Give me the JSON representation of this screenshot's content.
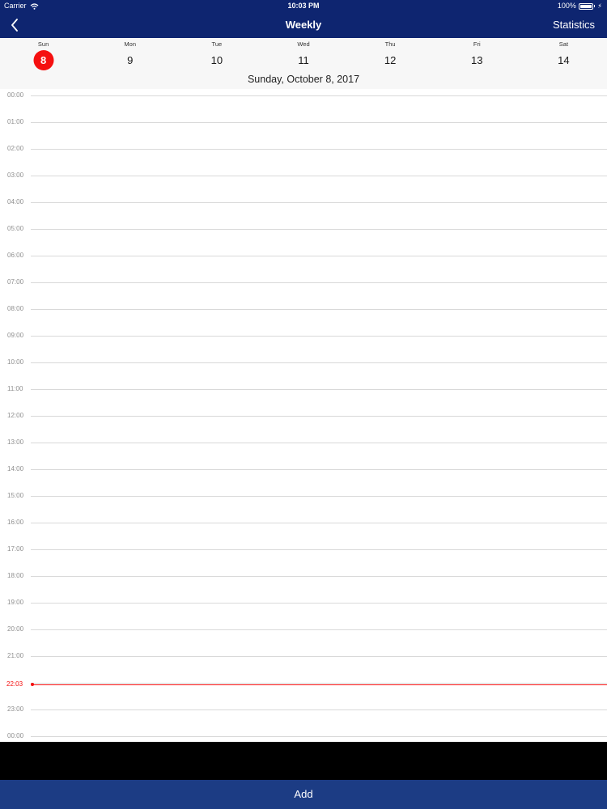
{
  "colors": {
    "nav": "#0e2570",
    "accent": "#f51010",
    "bar": "#1c3c84"
  },
  "status_bar": {
    "carrier": "Carrier",
    "time": "10:03 PM",
    "battery": "100%"
  },
  "nav": {
    "title": "Weekly",
    "back_icon": "chevron-left-icon",
    "right_button": "Statistics"
  },
  "week": {
    "days": [
      {
        "name": "Sun",
        "num": "8",
        "selected": true
      },
      {
        "name": "Mon",
        "num": "9"
      },
      {
        "name": "Tue",
        "num": "10"
      },
      {
        "name": "Wed",
        "num": "11"
      },
      {
        "name": "Thu",
        "num": "12"
      },
      {
        "name": "Fri",
        "num": "13"
      },
      {
        "name": "Sat",
        "num": "14"
      }
    ],
    "selected_date": "Sunday, October 8, 2017"
  },
  "timeline": {
    "hours": [
      "00:00",
      "01:00",
      "02:00",
      "03:00",
      "04:00",
      "05:00",
      "06:00",
      "07:00",
      "08:00",
      "09:00",
      "10:00",
      "11:00",
      "12:00",
      "13:00",
      "14:00",
      "15:00",
      "16:00",
      "17:00",
      "18:00",
      "19:00",
      "20:00",
      "21:00",
      "22:00",
      "23:00",
      "00:00"
    ],
    "current_time": "22:03"
  },
  "footer": {
    "add_label": "Add"
  }
}
